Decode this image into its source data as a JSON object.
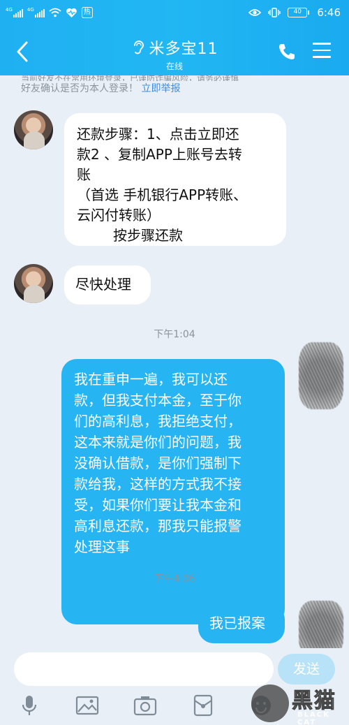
{
  "status_bar": {
    "network_1": "4G",
    "network_2": "4G",
    "hot_badge": "热",
    "battery": "40",
    "time": "6:46"
  },
  "header": {
    "title": "米多宝11",
    "subtitle": "在线"
  },
  "chat": {
    "system_notice_clipped": "当前好友不在常用环境登录，已谨防诈骗风险，请务必谨慎",
    "system_notice_text": "好友确认是否为本人登录！",
    "system_notice_link": "立即举报",
    "messages": [
      {
        "side": "in",
        "lines": [
          "还款步骤：1、点击立即还",
          "款2 、复制APP上账号去转",
          "账",
          "（首选 手机银行APP转账、",
          "云闪付转账）",
          "按步骤还款"
        ]
      },
      {
        "side": "in",
        "lines": [
          "尽快处理"
        ]
      },
      {
        "side": "time",
        "text": "下午1:04"
      },
      {
        "side": "out",
        "lines": [
          "我在重申一遍，我可以还",
          "款，但我支付本金，至于你",
          "们的高利息，我拒绝支付，",
          "这本来就是你们的问题，我",
          "没确认借款，是你们强制下",
          "款给我，这样的方式我不接",
          "受，如果你们要让我本金和",
          "高利息还款，那我只能报警",
          "处理这事"
        ]
      },
      {
        "side": "time",
        "text": "下午4:06"
      },
      {
        "side": "out",
        "lines": [
          "我已报案"
        ]
      }
    ]
  },
  "input": {
    "placeholder": "",
    "send_label": "发送"
  },
  "toolbar": {
    "icons": [
      "microphone-icon",
      "image-icon",
      "camera-icon",
      "red-packet-icon",
      "emoji-icon"
    ]
  },
  "watermark": {
    "text": "黑猫",
    "sub": "BLACK CAT"
  },
  "colors": {
    "header": "#21b7f3",
    "outgoing_bubble": "#27b4f2",
    "incoming_bubble": "#ffffff",
    "background": "#e9eff6",
    "link": "#3b8de0"
  }
}
